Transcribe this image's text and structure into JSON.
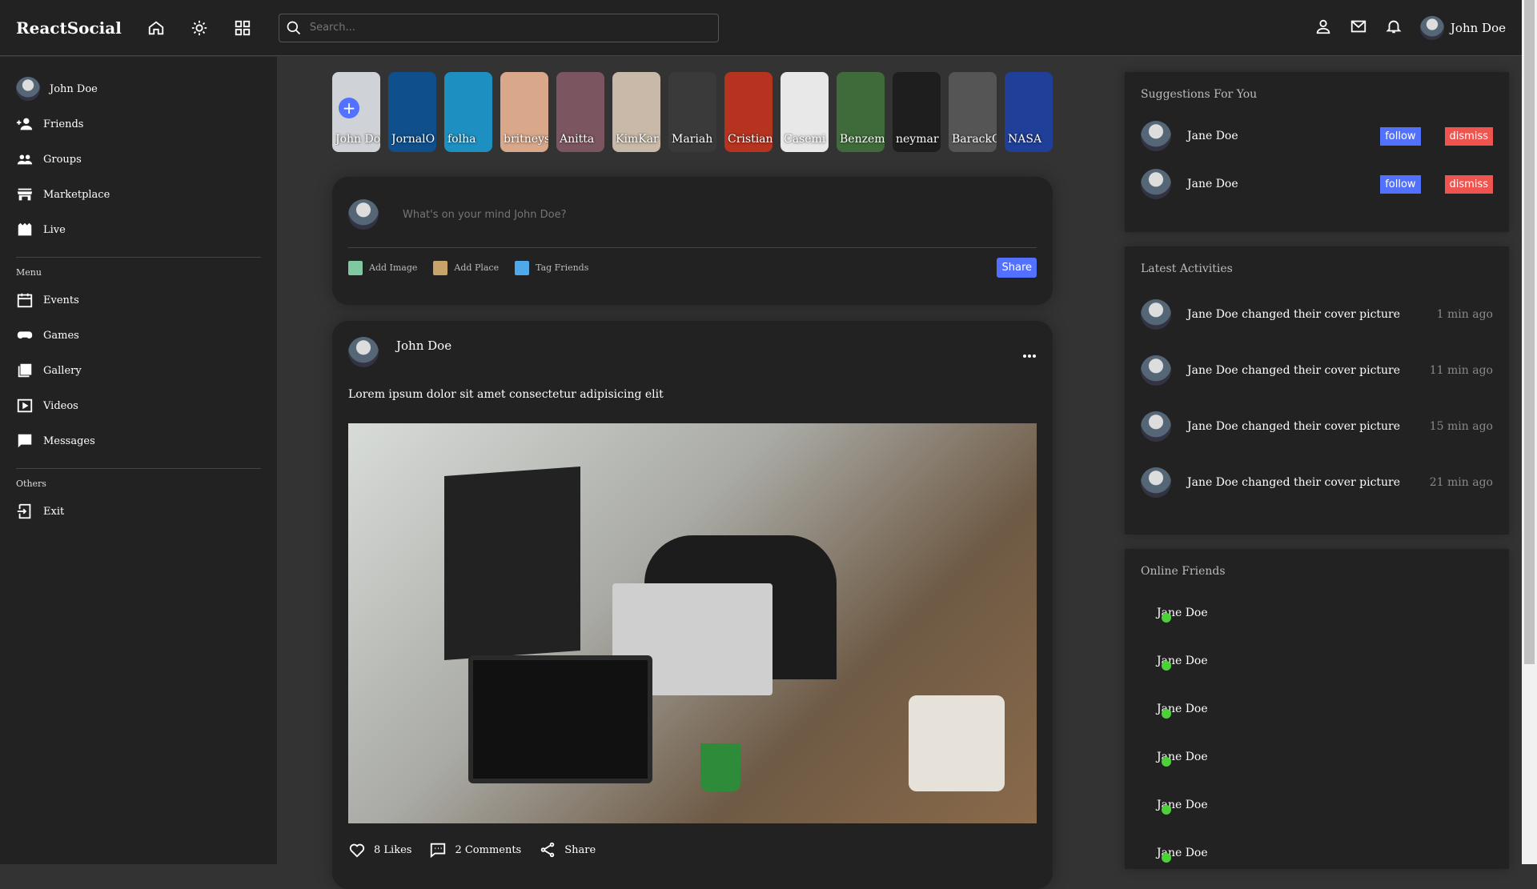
{
  "app": {
    "logo": "ReactSocial",
    "accent": "#5271ff",
    "danger": "#f0544f",
    "online": "#4cd137"
  },
  "search": {
    "placeholder": "Search..."
  },
  "header": {
    "user_name": "John Doe"
  },
  "sidebar": {
    "user_name": "John Doe",
    "items": [
      {
        "label": "Friends",
        "icon": "add-friend-icon"
      },
      {
        "label": "Groups",
        "icon": "groups-icon"
      },
      {
        "label": "Marketplace",
        "icon": "store-icon"
      },
      {
        "label": "Live",
        "icon": "video-clapper-icon"
      }
    ],
    "menu_title": "Menu",
    "menu_items": [
      {
        "label": "Events",
        "icon": "calendar-icon"
      },
      {
        "label": "Games",
        "icon": "gamepad-icon"
      },
      {
        "label": "Gallery",
        "icon": "gallery-icon"
      },
      {
        "label": "Videos",
        "icon": "play-icon"
      },
      {
        "label": "Messages",
        "icon": "message-icon"
      }
    ],
    "others_title": "Others",
    "other_items": [
      {
        "label": "Exit",
        "icon": "exit-icon"
      }
    ]
  },
  "stories": [
    {
      "name": "John Doe",
      "color": "#cfd2d6"
    },
    {
      "name": "JornalO",
      "color": "#0f4f8c"
    },
    {
      "name": "folha",
      "color": "#1d8fc0"
    },
    {
      "name": "britneys",
      "color": "#d9a88a"
    },
    {
      "name": "Anitta",
      "color": "#7b5560"
    },
    {
      "name": "KimKar",
      "color": "#c9b9a8"
    },
    {
      "name": "Mariah",
      "color": "#3a3a3a"
    },
    {
      "name": "Cristian",
      "color": "#b5331f"
    },
    {
      "name": "Casemi",
      "color": "#e8e8e8"
    },
    {
      "name": "Benzem",
      "color": "#3f6b3a"
    },
    {
      "name": "neymar",
      "color": "#1e1e1e"
    },
    {
      "name": "BarackO",
      "color": "#555555"
    },
    {
      "name": "NASA",
      "color": "#1f3f99"
    }
  ],
  "share": {
    "placeholder": "What's on your mind John Doe?",
    "add_image": "Add Image",
    "add_place": "Add Place",
    "tag_friends": "Tag Friends",
    "button": "Share"
  },
  "post": {
    "user_name": "John Doe",
    "text": "Lorem ipsum dolor sit amet consectetur adipisicing elit",
    "likes": "8 Likes",
    "comments": "2 Comments",
    "share": "Share"
  },
  "suggestions": {
    "title": "Suggestions For You",
    "users": [
      {
        "name": "Jane Doe"
      },
      {
        "name": "Jane Doe"
      }
    ],
    "follow": "follow",
    "dismiss": "dismiss"
  },
  "activities": {
    "title": "Latest Activities",
    "items": [
      {
        "text": "Jane Doe changed their cover picture",
        "time": "1 min ago"
      },
      {
        "text": "Jane Doe changed their cover picture",
        "time": "11 min ago"
      },
      {
        "text": "Jane Doe changed their cover picture",
        "time": "15 min ago"
      },
      {
        "text": "Jane Doe changed their cover picture",
        "time": "21 min ago"
      }
    ]
  },
  "online_friends": {
    "title": "Online Friends",
    "users": [
      {
        "name": "Jane Doe"
      },
      {
        "name": "Jane Doe"
      },
      {
        "name": "Jane Doe"
      },
      {
        "name": "Jane Doe"
      },
      {
        "name": "Jane Doe"
      },
      {
        "name": "Jane Doe"
      }
    ]
  }
}
